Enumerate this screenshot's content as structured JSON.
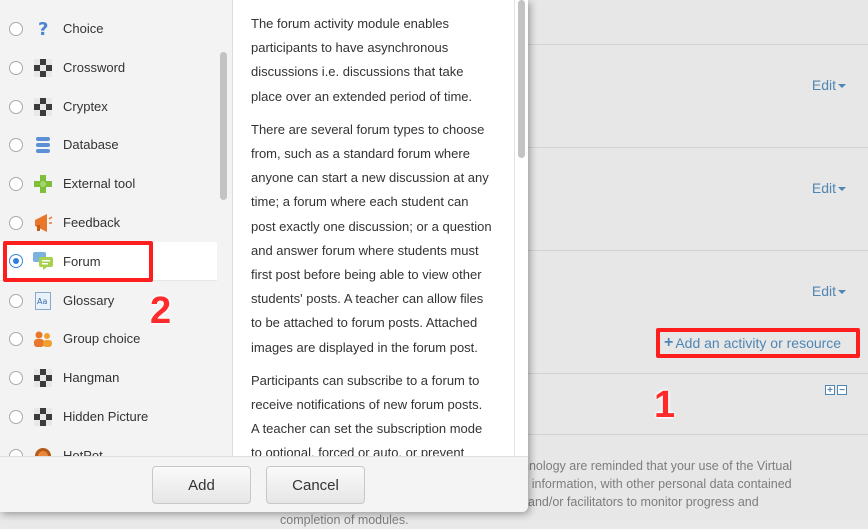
{
  "background": {
    "edit_links": [
      "Edit",
      "Edit",
      "Edit"
    ],
    "add_activity_label": "Add an activity or resource",
    "annotation_1": "1",
    "footer_lines": [
      "hnology are reminded that your use of the Virtual",
      "s information, with other personal data contained",
      "and/or facilitators to monitor progress and",
      "completion of modules."
    ]
  },
  "dialog": {
    "annotation_2": "2",
    "items": [
      {
        "label": "Choice",
        "icon": "choice-icon"
      },
      {
        "label": "Crossword",
        "icon": "crossword-icon"
      },
      {
        "label": "Cryptex",
        "icon": "cryptex-icon"
      },
      {
        "label": "Database",
        "icon": "database-icon"
      },
      {
        "label": "External tool",
        "icon": "external-tool-icon"
      },
      {
        "label": "Feedback",
        "icon": "feedback-icon"
      },
      {
        "label": "Forum",
        "icon": "forum-icon",
        "selected": true
      },
      {
        "label": "Glossary",
        "icon": "glossary-icon"
      },
      {
        "label": "Group choice",
        "icon": "group-choice-icon"
      },
      {
        "label": "Hangman",
        "icon": "hangman-icon"
      },
      {
        "label": "Hidden Picture",
        "icon": "hidden-picture-icon"
      },
      {
        "label": "HotPot",
        "icon": "hotpot-icon"
      }
    ],
    "description": [
      [
        "The forum activity module enables",
        "participants to have asynchronous",
        "discussions i.e. discussions that take",
        "place over an extended period of time."
      ],
      [
        "There are several forum types to choose",
        "from, such as a standard forum where",
        "anyone can start a new discussion at any",
        "time; a forum where each student can",
        "post exactly one discussion; or a question",
        "and answer forum where students must",
        "first post before being able to view other",
        "students' posts. A teacher can allow files",
        "to be attached to forum posts. Attached",
        "images are displayed in the forum post."
      ],
      [
        "Participants can subscribe to a forum to",
        "receive notifications of new forum posts.",
        "A teacher can set the subscription mode",
        "to optional, forced or auto, or prevent"
      ]
    ],
    "add_button": "Add",
    "cancel_button": "Cancel"
  }
}
